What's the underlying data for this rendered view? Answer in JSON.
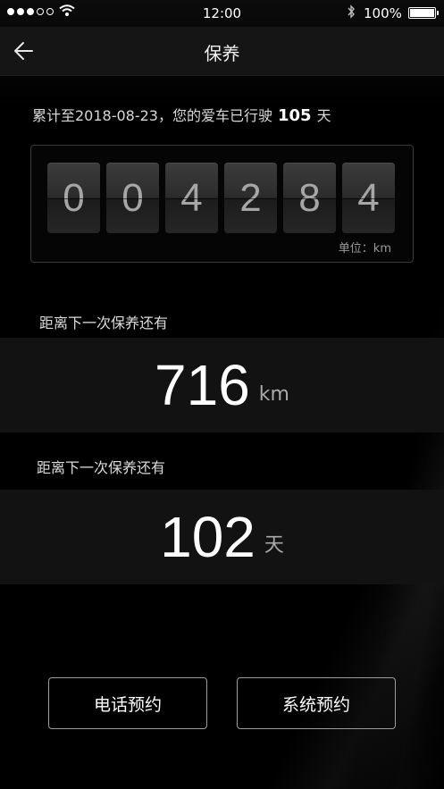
{
  "status_bar": {
    "time": "12:00",
    "battery": "100%",
    "signal_filled": 3,
    "signal_total": 5
  },
  "nav": {
    "title": "保养",
    "back_icon": "arrow-left-icon"
  },
  "summary": {
    "prefix": "累计至2018-08-23，您的爱车已行驶",
    "days": "105",
    "suffix": "天"
  },
  "odometer": {
    "digits": [
      "0",
      "0",
      "4",
      "2",
      "8",
      "4"
    ],
    "unit_label": "单位：km"
  },
  "next_km": {
    "label": "距离下一次保养还有",
    "value": "716",
    "unit": "km"
  },
  "next_days": {
    "label": "距离下一次保养还有",
    "value": "102",
    "unit": "天"
  },
  "actions": {
    "phone_label": "电话预约",
    "system_label": "系统预约"
  },
  "colors": {
    "background": "#000000",
    "band": "#121212",
    "digit_text": "#a6a6a6"
  }
}
